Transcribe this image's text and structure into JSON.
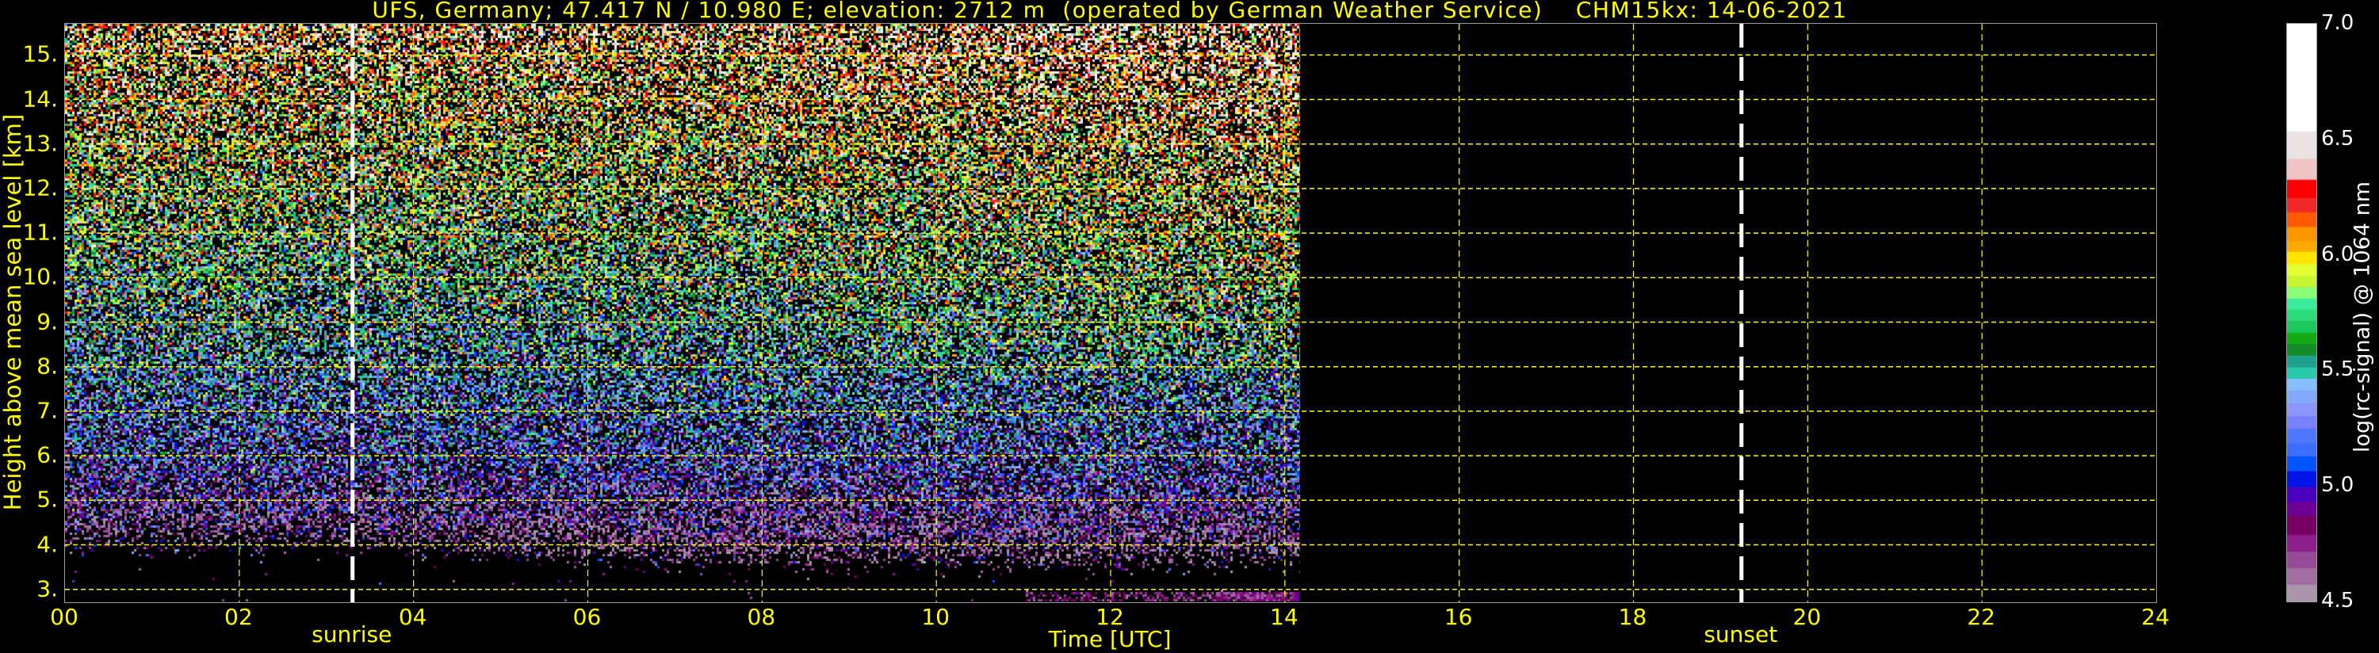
{
  "chart_data": {
    "type": "heatmap",
    "title": "UFS, Germany; 47.417 N / 10.980 E; elevation: 2712 m  (operated by German Weather Service)    CHM15kx: 14-06-2021",
    "xlabel": "Time [UTC]",
    "ylabel": "Height above mean sea level [km]",
    "xlim": [
      0,
      24
    ],
    "ylim": [
      2.71,
      15.7
    ],
    "xticks": [
      0,
      2,
      4,
      6,
      8,
      10,
      12,
      14,
      16,
      18,
      20,
      22,
      24
    ],
    "xtick_labels": [
      "00",
      "02",
      "04",
      "06",
      "08",
      "10",
      "12",
      "14",
      "16",
      "18",
      "20",
      "22",
      "24"
    ],
    "yticks": [
      3,
      4,
      5,
      6,
      7,
      8,
      9,
      10,
      11,
      12,
      13,
      14,
      15
    ],
    "ytick_labels": [
      "3.",
      "4.",
      "5.",
      "6.",
      "7.",
      "8.",
      "9.",
      "10.",
      "11.",
      "12.",
      "13.",
      "14.",
      "15."
    ],
    "grid": true,
    "data_coverage_hours": [
      0,
      14.17
    ],
    "events": [
      {
        "label": "sunrise",
        "time": 3.3
      },
      {
        "label": "sunset",
        "time": 19.24
      }
    ],
    "approx_mean_profile": {
      "height_km": [
        3.5,
        4.0,
        4.5,
        5.0,
        6.0,
        7.0,
        8.0,
        10.0,
        12.0,
        14.0,
        15.5
      ],
      "log_signal": [
        4.4,
        4.55,
        4.7,
        4.85,
        5.1,
        5.25,
        5.4,
        5.65,
        5.85,
        6.05,
        6.2
      ]
    },
    "low_signal_layer": {
      "time": [
        11.0,
        14.17
      ],
      "height_km": [
        2.73,
        2.97
      ],
      "log_signal": [
        4.6,
        4.9
      ]
    },
    "colorbar": {
      "label": "log(rc-signal) @ 1064 nm",
      "range": [
        4.5,
        7.0
      ],
      "ticks": [
        4.5,
        5.0,
        5.5,
        6.0,
        6.5,
        7.0
      ],
      "tick_labels": [
        "4.5",
        "5.0",
        "5.5",
        "6.0",
        "6.5",
        "7.0"
      ],
      "boundaries": [
        7.0,
        6.535,
        6.415,
        6.325,
        6.247,
        6.184,
        6.121,
        6.063,
        6.013,
        5.959,
        5.91,
        5.86,
        5.811,
        5.763,
        5.714,
        5.663,
        5.615,
        5.564,
        5.514,
        5.464,
        5.411,
        5.356,
        5.301,
        5.247,
        5.184,
        5.127,
        5.064,
        4.995,
        4.929,
        4.871,
        4.788,
        4.716,
        4.644,
        4.572,
        4.5
      ],
      "colors": [
        "#ffffff",
        "#ebe3e3",
        "#efc4c4",
        "#ff0000",
        "#f02828",
        "#ff5a00",
        "#ff9600",
        "#ffaa00",
        "#ffe600",
        "#e1ff32",
        "#c8f532",
        "#8cff78",
        "#3ceb9b",
        "#2ddc78",
        "#1ec85a",
        "#14aa14",
        "#148c28",
        "#1ea08c",
        "#28c8aa",
        "#87beff",
        "#82aaff",
        "#8c96ff",
        "#7882ff",
        "#5078ff",
        "#3c6eff",
        "#0055ff",
        "#0014e6",
        "#4b00be",
        "#6e0096",
        "#780064",
        "#8c1e8c",
        "#964b96",
        "#a06ea0",
        "#aa96aa"
      ]
    },
    "colors": {
      "text": "#ffff00",
      "grid": "#ffff00",
      "event_line": "#ffffff",
      "background": "#000000"
    }
  }
}
